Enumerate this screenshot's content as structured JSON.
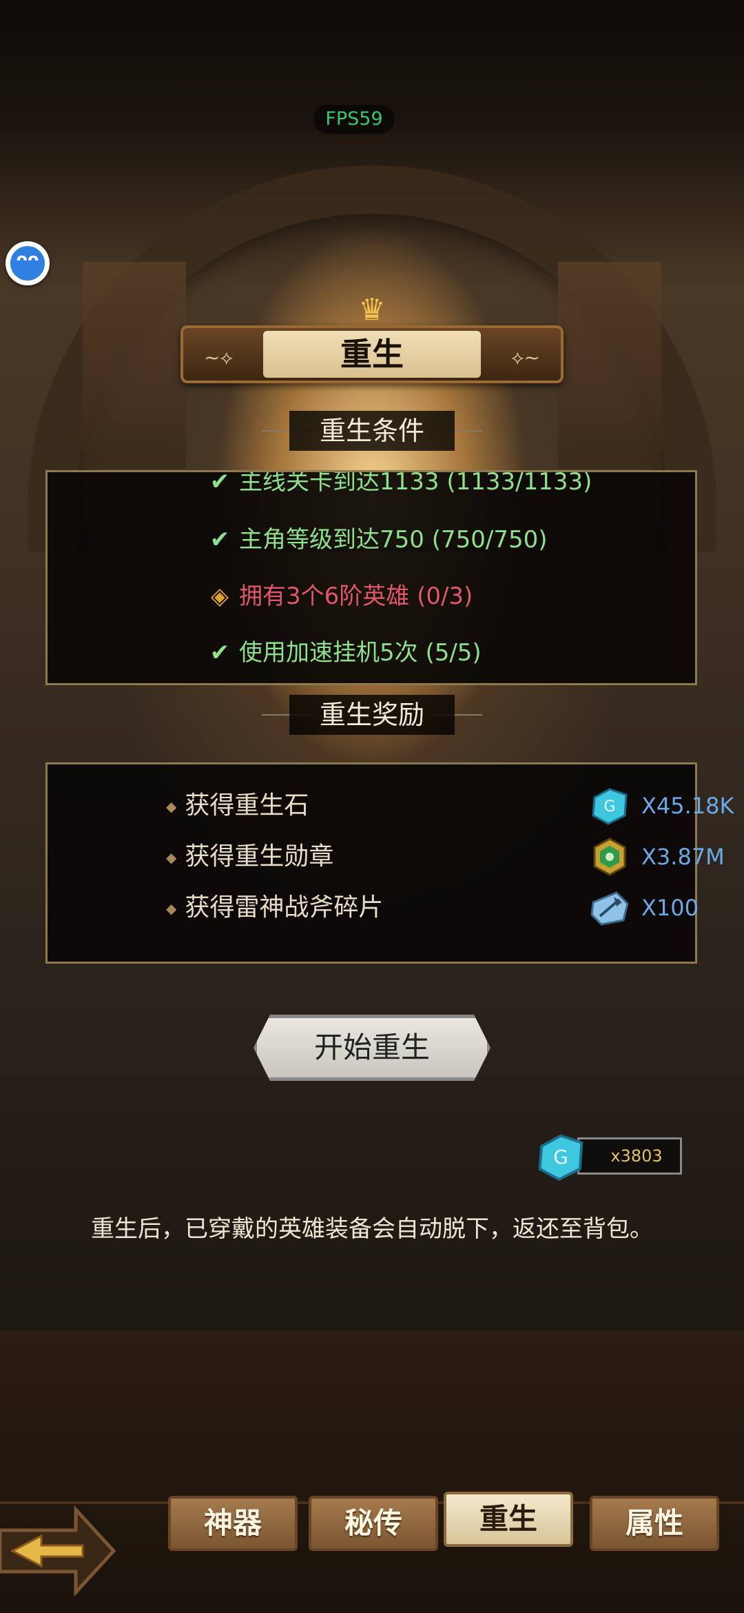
{
  "fps": "FPS59",
  "assistant": {
    "icon": "face-icon",
    "glyph": "ᴖᴖ"
  },
  "banner": {
    "title": "重生",
    "crown_icon": "crown-icon"
  },
  "conditions_section": {
    "label": "重生条件",
    "items": [
      {
        "text": "主线关卡到达1133 (1133/1133)",
        "status": "done",
        "color": "#8ee08a"
      },
      {
        "text": "主角等级到达750 (750/750)",
        "status": "done",
        "color": "#8ee08a"
      },
      {
        "text": "拥有3个6阶英雄 (0/3)",
        "status": "pending",
        "color": "#e0566a"
      },
      {
        "text": "使用加速挂机5次 (5/5)",
        "status": "done",
        "color": "#8ee08a"
      }
    ]
  },
  "rewards_section": {
    "label": "重生奖励",
    "items": [
      {
        "label": "获得重生石",
        "icon": "rebirth-stone-icon",
        "amount": "X45.18K"
      },
      {
        "label": "获得重生勋章",
        "icon": "rebirth-medal-icon",
        "amount": "X3.87M"
      },
      {
        "label": "获得雷神战斧碎片",
        "icon": "thunder-axe-fragment-icon",
        "amount": "X100"
      }
    ]
  },
  "start_button": {
    "label": "开始重生"
  },
  "cost": {
    "icon": "rebirth-stone-icon",
    "amount": "x3803"
  },
  "note": "重生后，已穿戴的英雄装备会自动脱下，返还至背包。",
  "tabs": [
    {
      "label": "神器",
      "active": false
    },
    {
      "label": "秘传",
      "active": false
    },
    {
      "label": "重生",
      "active": true
    },
    {
      "label": "属性",
      "active": false
    }
  ],
  "back_button": {
    "icon": "arrow-left-icon"
  },
  "colors": {
    "done": "#8ee08a",
    "pending": "#e0566a",
    "reward_value": "#6aa8e8",
    "cost": "#e8c060"
  }
}
